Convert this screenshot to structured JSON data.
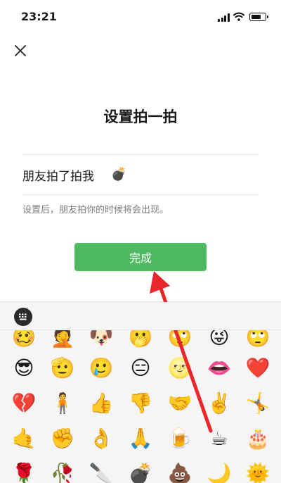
{
  "status_bar": {
    "time": "23:21",
    "battery_level": 0.75
  },
  "header": {
    "close_icon": "close-icon"
  },
  "page": {
    "title": "设置拍一拍",
    "pat_text": "朋友拍了拍我",
    "pat_emoji": "💣",
    "hint": "设置后，朋友拍你的时候将会出现。",
    "done_label": "完成"
  },
  "emoji_panel": {
    "keyboard_icon": "keyboard-icon",
    "rows": [
      [
        "🥴",
        "🤦",
        "🐶",
        "🫢",
        "🙄",
        "😜",
        "🙄"
      ],
      [
        "😎",
        "🫡",
        "🥲",
        "😑",
        "🌝",
        "👄",
        "❤️"
      ],
      [
        "💔",
        "🧍",
        "👍",
        "👎",
        "🤝",
        "✌️",
        "🤸"
      ],
      [
        "🤙",
        "✊",
        "👌",
        "🙏",
        "🍺",
        "☕",
        "🎂"
      ],
      [
        "🌹",
        "🥀",
        "🔪",
        "💣",
        "💩",
        "🌙",
        "🌞"
      ]
    ]
  },
  "annotation": {
    "arrow_color": "#e8262b"
  }
}
